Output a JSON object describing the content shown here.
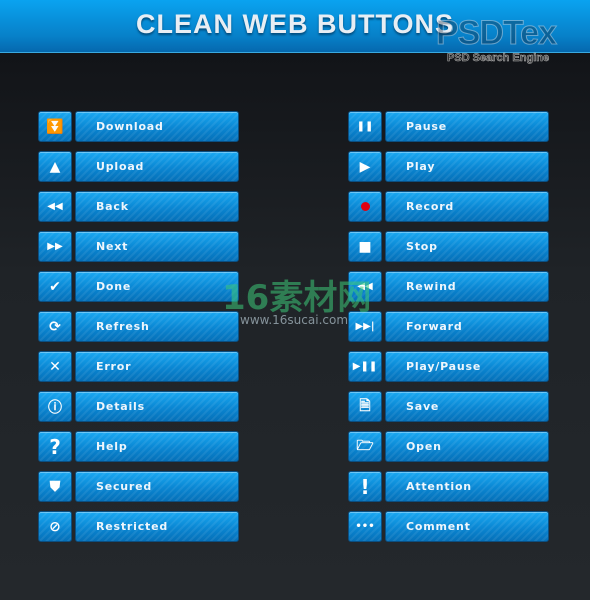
{
  "header": {
    "title": "CLEAN WEB BUTTONS"
  },
  "watermarks": {
    "brand": "PSDTex",
    "tagline": "PSD Search Engine",
    "site_cn": "16素材网",
    "site_url": "www.16sucai.com"
  },
  "colors": {
    "button_blue": "#0a86d2",
    "header_blue": "#0aa3f0",
    "background": "#1d2024",
    "record_red": "#e00010"
  },
  "left_buttons": [
    {
      "label": "Download",
      "icon": "double-chevron-down",
      "glyph": "⏬"
    },
    {
      "label": "Upload",
      "icon": "triangle-up",
      "glyph": "▲"
    },
    {
      "label": "Back",
      "icon": "rewind-arrows",
      "glyph": "◀◀"
    },
    {
      "label": "Next",
      "icon": "fast-forward-arrows",
      "glyph": "▶▶"
    },
    {
      "label": "Done",
      "icon": "checkmark",
      "glyph": "✔"
    },
    {
      "label": "Refresh",
      "icon": "refresh",
      "glyph": "⟳"
    },
    {
      "label": "Error",
      "icon": "x-mark",
      "glyph": "✕"
    },
    {
      "label": "Details",
      "icon": "info",
      "glyph": "ⓘ"
    },
    {
      "label": "Help",
      "icon": "question-mark",
      "glyph": "?"
    },
    {
      "label": "Secured",
      "icon": "shield",
      "glyph": "⛊"
    },
    {
      "label": "Restricted",
      "icon": "no-entry",
      "glyph": "⊘"
    }
  ],
  "right_buttons": [
    {
      "label": "Pause",
      "icon": "pause",
      "glyph": "❚❚"
    },
    {
      "label": "Play",
      "icon": "play",
      "glyph": "▶"
    },
    {
      "label": "Record",
      "icon": "record",
      "glyph": ""
    },
    {
      "label": "Stop",
      "icon": "stop",
      "glyph": "■"
    },
    {
      "label": "Rewind",
      "icon": "rewind",
      "glyph": "◀◀"
    },
    {
      "label": "Forward",
      "icon": "skip-forward",
      "glyph": "▶▶|"
    },
    {
      "label": "Play/Pause",
      "icon": "play-pause",
      "glyph": "▶❚❚"
    },
    {
      "label": "Save",
      "icon": "document",
      "glyph": "🗎"
    },
    {
      "label": "Open",
      "icon": "folder-open",
      "glyph": "🗁"
    },
    {
      "label": "Attention",
      "icon": "exclamation",
      "glyph": "!"
    },
    {
      "label": "Comment",
      "icon": "ellipsis",
      "glyph": "•••"
    }
  ]
}
